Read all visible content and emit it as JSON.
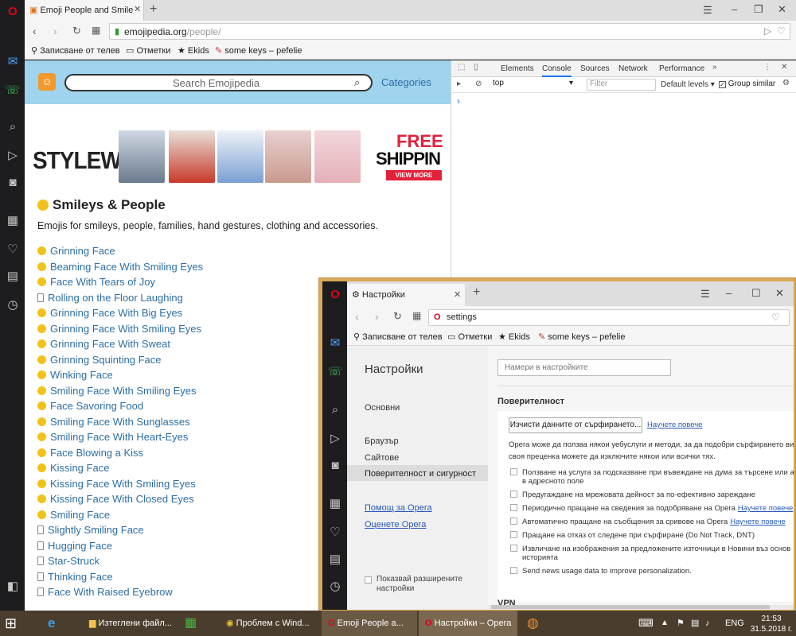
{
  "main_window": {
    "tab_title": "Emoji People and Smile",
    "url_domain": "emojipedia.org",
    "url_path": "/people/",
    "bookmarks": [
      "Записване от телев",
      "Отметки",
      "Ekids",
      "some keys – pefelie"
    ]
  },
  "emojipedia": {
    "search_placeholder": "Search Emojipedia",
    "categories_link": "Categories",
    "ad_brand": "STYLEWE",
    "ad_free": "FREE",
    "ad_shipping": "SHIPPIN",
    "ad_view_more": "VIEW MORE",
    "page_title": "Smileys & People",
    "page_description": "Emojis for smileys, people, families, hand gestures, clothing and accessories.",
    "emoji_items": [
      {
        "label": "Grinning Face",
        "icon": true
      },
      {
        "label": "Beaming Face With Smiling Eyes",
        "icon": true
      },
      {
        "label": "Face With Tears of Joy",
        "icon": true
      },
      {
        "label": "Rolling on the Floor Laughing",
        "icon": false
      },
      {
        "label": "Grinning Face With Big Eyes",
        "icon": true
      },
      {
        "label": "Grinning Face With Smiling Eyes",
        "icon": true
      },
      {
        "label": "Grinning Face With Sweat",
        "icon": true
      },
      {
        "label": "Grinning Squinting Face",
        "icon": true
      },
      {
        "label": "Winking Face",
        "icon": true
      },
      {
        "label": "Smiling Face With Smiling Eyes",
        "icon": true
      },
      {
        "label": "Face Savoring Food",
        "icon": true
      },
      {
        "label": "Smiling Face With Sunglasses",
        "icon": true
      },
      {
        "label": "Smiling Face With Heart-Eyes",
        "icon": true
      },
      {
        "label": "Face Blowing a Kiss",
        "icon": true
      },
      {
        "label": "Kissing Face",
        "icon": true
      },
      {
        "label": "Kissing Face With Smiling Eyes",
        "icon": true
      },
      {
        "label": "Kissing Face With Closed Eyes",
        "icon": true
      },
      {
        "label": "Smiling Face",
        "icon": true
      },
      {
        "label": "Slightly Smiling Face",
        "icon": false
      },
      {
        "label": "Hugging Face",
        "icon": false
      },
      {
        "label": "Star-Struck",
        "icon": false
      },
      {
        "label": "Thinking Face",
        "icon": false
      },
      {
        "label": "Face With Raised Eyebrow",
        "icon": false
      }
    ]
  },
  "devtools": {
    "tabs": [
      "Elements",
      "Console",
      "Sources",
      "Network",
      "Performance"
    ],
    "active_tab": "Console",
    "context": "top",
    "filter_placeholder": "Filter",
    "levels": "Default levels ▾",
    "group_similar": "Group similar",
    "prompt": "›"
  },
  "settings_window": {
    "tab_title": "Настройки",
    "url": "settings",
    "bookmarks": [
      "Записване от телев",
      "Отметки",
      "Ekids",
      "some keys – pefelie"
    ],
    "heading": "Настройки",
    "search_placeholder": "Намери в настройките",
    "nav": [
      "Основни",
      "Браузър",
      "Сайтове",
      "Поверителност и сигурност"
    ],
    "nav_links": [
      "Помощ за Opera",
      "Оценете Opera"
    ],
    "show_advanced": "Показвай разширените настройки",
    "section_title": "Поверителност",
    "clear_button": "Изчисти данните от сърфирането...",
    "learn_more": "Научете повече",
    "description": "Opera може да ползва някои уебуслуги и методи, за да подобри сърфирането ви. По своя преценка можете да изключите някои или всички тях.",
    "description_line1": "Opera може да ползва някои уебуслуги и методи, за да подобри сърфирането ви",
    "description_line2": "своя преценка можете да изключите някои или всички тях.",
    "options": [
      {
        "text": "Ползване на услуга за подсказване при въвеждане на дума за търсене или ад",
        "text2": "в адресното поле",
        "link": ""
      },
      {
        "text": "Предугаждане на мрежовата дейност за по-ефективно зареждане",
        "text2": "",
        "link": ""
      },
      {
        "text": "Периодично пращане на сведения за подобряване на Opera",
        "text2": "",
        "link": "Научете повече"
      },
      {
        "text": "Автоматично пращане на съобщения за сривове на Opera",
        "text2": "",
        "link": "Научете повече"
      },
      {
        "text": "Пращане на отказ от следене при сърфиране (Do Not Track, DNT)",
        "text2": "",
        "link": ""
      },
      {
        "text": "Извличане на изображения за предложените източници в Новини въз основ",
        "text2": "историята",
        "link": ""
      },
      {
        "text": "Send news usage data to improve personalization.",
        "text2": "",
        "link": ""
      }
    ],
    "vpn_title": "VPN"
  },
  "taskbar": {
    "items": [
      "Изтеглени файл...",
      "Проблем с Wind...",
      "Emoji People a...",
      "Настройки – Opera"
    ],
    "language": "ENG",
    "time": "21:53",
    "date": "31.5.2018 г."
  },
  "colors": {
    "emojipedia_header": "#9fd3ee",
    "link_blue": "#2c6ea5",
    "opera_red": "#e0001b",
    "settings_border": "#d9a957"
  }
}
